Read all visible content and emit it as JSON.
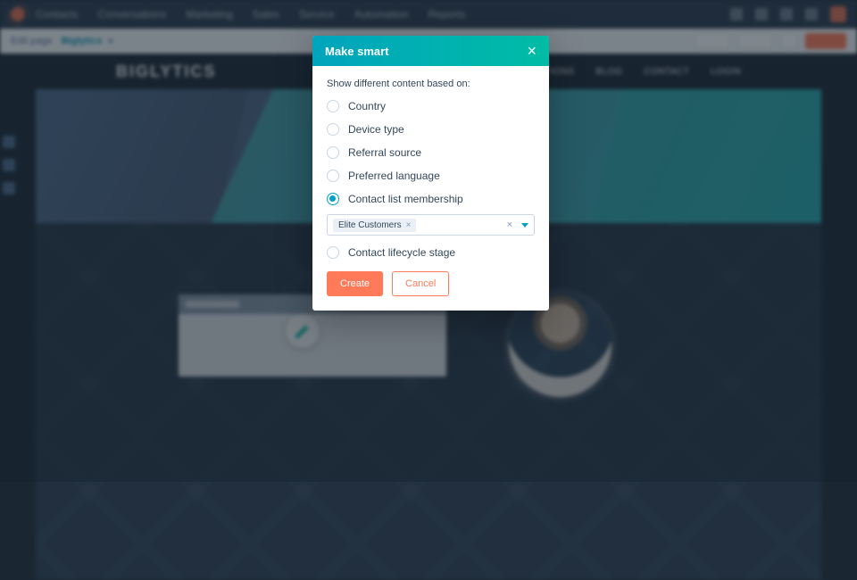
{
  "topnav": {
    "items": [
      "Contacts",
      "Conversations",
      "Marketing",
      "Sales",
      "Service",
      "Automation",
      "Reports"
    ]
  },
  "subbar": {
    "context": "Edit page",
    "brand": "Biglytics"
  },
  "site": {
    "logo": "BIGLYTICS",
    "nav": [
      "SOLUTIONS",
      "BLOG",
      "CONTACT",
      "LOGIN"
    ]
  },
  "modal": {
    "title": "Make smart",
    "prompt": "Show different content based on:",
    "options": [
      {
        "label": "Country",
        "selected": false
      },
      {
        "label": "Device type",
        "selected": false
      },
      {
        "label": "Referral source",
        "selected": false
      },
      {
        "label": "Preferred language",
        "selected": false
      },
      {
        "label": "Contact list membership",
        "selected": true
      },
      {
        "label": "Contact lifecycle stage",
        "selected": false
      }
    ],
    "list_chip": "Elite Customers",
    "create": "Create",
    "cancel": "Cancel"
  }
}
